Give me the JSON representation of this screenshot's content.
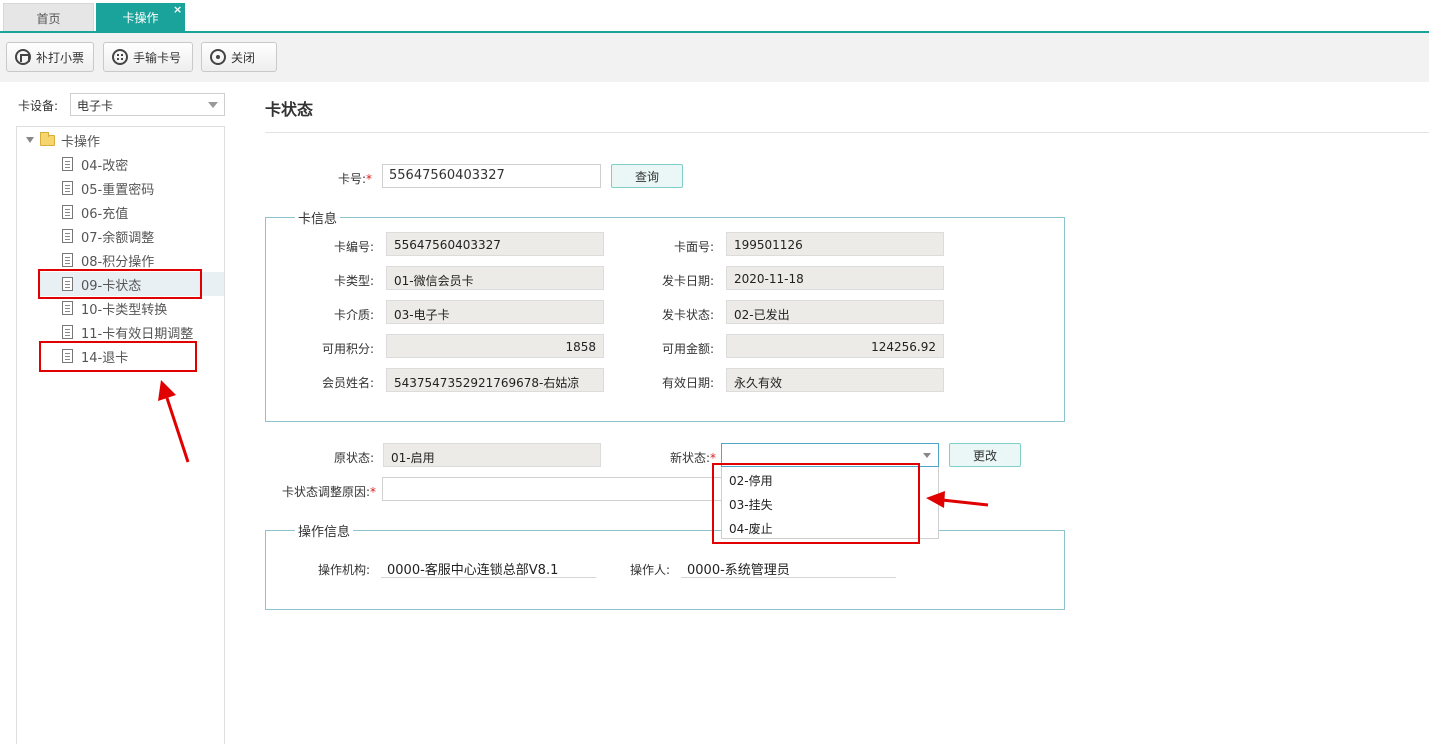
{
  "tabs": [
    {
      "label": "首页"
    },
    {
      "label": "卡操作",
      "close": "×"
    }
  ],
  "toolbar": {
    "reprint_label": "补打小票",
    "manual_card_label": "手输卡号",
    "close_label": "关闭"
  },
  "sidebar": {
    "device_label": "卡设备:",
    "device_value": "电子卡",
    "root_label": "卡操作",
    "items": [
      {
        "label": "04-改密"
      },
      {
        "label": "05-重置密码"
      },
      {
        "label": "06-充值"
      },
      {
        "label": "07-余额调整"
      },
      {
        "label": "08-积分操作"
      },
      {
        "label": "09-卡状态"
      },
      {
        "label": "10-卡类型转换"
      },
      {
        "label": "11-卡有效日期调整"
      },
      {
        "label": "14-退卡"
      }
    ]
  },
  "main": {
    "title": "卡状态",
    "card_no_label": "卡号:",
    "required_mark": "*",
    "card_no_value": "55647560403327",
    "query_label": "查询",
    "card_info": {
      "legend": "卡信息",
      "card_code_label": "卡编号:",
      "card_code": "55647560403327",
      "card_face_label": "卡面号:",
      "card_face": "199501126",
      "card_type_label": "卡类型:",
      "card_type": "01-微信会员卡",
      "issue_date_label": "发卡日期:",
      "issue_date": "2020-11-18",
      "medium_label": "卡介质:",
      "medium": "03-电子卡",
      "issue_status_label": "发卡状态:",
      "issue_status": "02-已发出",
      "points_label": "可用积分:",
      "points": "1858",
      "balance_label": "可用金额:",
      "balance": "124256.92",
      "member_label": "会员姓名:",
      "member": "5437547352921769678-右姑凉",
      "valid_label": "有效日期:",
      "valid": "永久有效"
    },
    "status": {
      "old_label": "原状态:",
      "old_value": "01-启用",
      "new_label": "新状态:",
      "change_label": "更改",
      "reason_label": "卡状态调整原因:",
      "options": [
        "02-停用",
        "03-挂失",
        "04-废止"
      ]
    },
    "op_info": {
      "legend": "操作信息",
      "org_label": "操作机构:",
      "org": "0000-客服中心连锁总部V8.1",
      "operator_label": "操作人:",
      "operator": "0000-系统管理员"
    }
  },
  "colors": {
    "accent": "#1aa39a",
    "annotation": "#e00000",
    "fieldset_border": "#8cc3cf"
  }
}
